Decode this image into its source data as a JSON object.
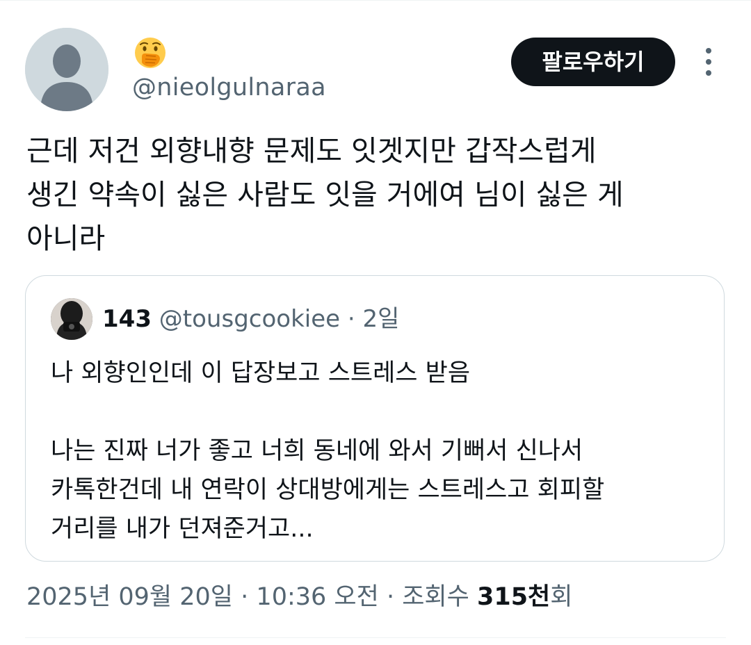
{
  "tweet": {
    "display_name_icon": "face-with-hand-over-mouth-emoji",
    "handle": "@nieolgulnaraa",
    "follow_label": "팔로우하기",
    "text": "근데 저건 외향내향 문제도 잇겟지만 갑작스럽게\n생긴 약속이 싫은 사람도 잇을 거에여 님이 싫은 게\n아니라"
  },
  "quote": {
    "name": "143",
    "handle": "@tousgcookiee",
    "separator": "·",
    "time": "2일",
    "text": "나 외향인인데 이 답장보고 스트레스 받음\n\n나는 진짜 너가 좋고 너희 동네에 와서 기뻐서 신나서\n카톡한건데 내 연락이 상대방에게는 스트레스고 회피할\n거리를 내가 던져준거고..."
  },
  "meta": {
    "date": "2025년 09월 20일",
    "separator": "·",
    "time": "10:36 오전",
    "views_label": "조회수",
    "views_count": "315천",
    "views_suffix": "회"
  },
  "colors": {
    "text_primary": "#0f1419",
    "text_secondary": "#536471",
    "border": "#cfd9de",
    "follow_bg": "#0f1419",
    "follow_text": "#ffffff",
    "emoji_yellow": "#ffcc4d"
  }
}
